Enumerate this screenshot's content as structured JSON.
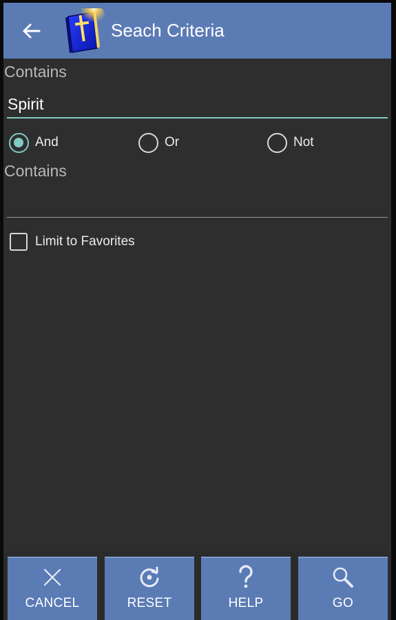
{
  "toolbar": {
    "title": "Seach Criteria",
    "back_icon": "arrow-left-icon",
    "app_icon": "bible-book-cross-icon",
    "background": "#5b7bb5"
  },
  "form": {
    "first_contains_label": "Contains",
    "first_contains_value": "Spirit",
    "operators": [
      {
        "label": "And",
        "selected": true
      },
      {
        "label": "Or",
        "selected": false
      },
      {
        "label": "Not",
        "selected": false
      }
    ],
    "second_contains_label": "Contains",
    "second_contains_value": "",
    "limit_to_favorites_label": "Limit to Favorites",
    "limit_to_favorites_checked": false,
    "accent_color": "#80cbc4"
  },
  "actions": [
    {
      "label": "CANCEL",
      "icon": "close-icon"
    },
    {
      "label": "RESET",
      "icon": "reset-icon"
    },
    {
      "label": "HELP",
      "icon": "question-icon"
    },
    {
      "label": "GO",
      "icon": "search-icon"
    }
  ]
}
